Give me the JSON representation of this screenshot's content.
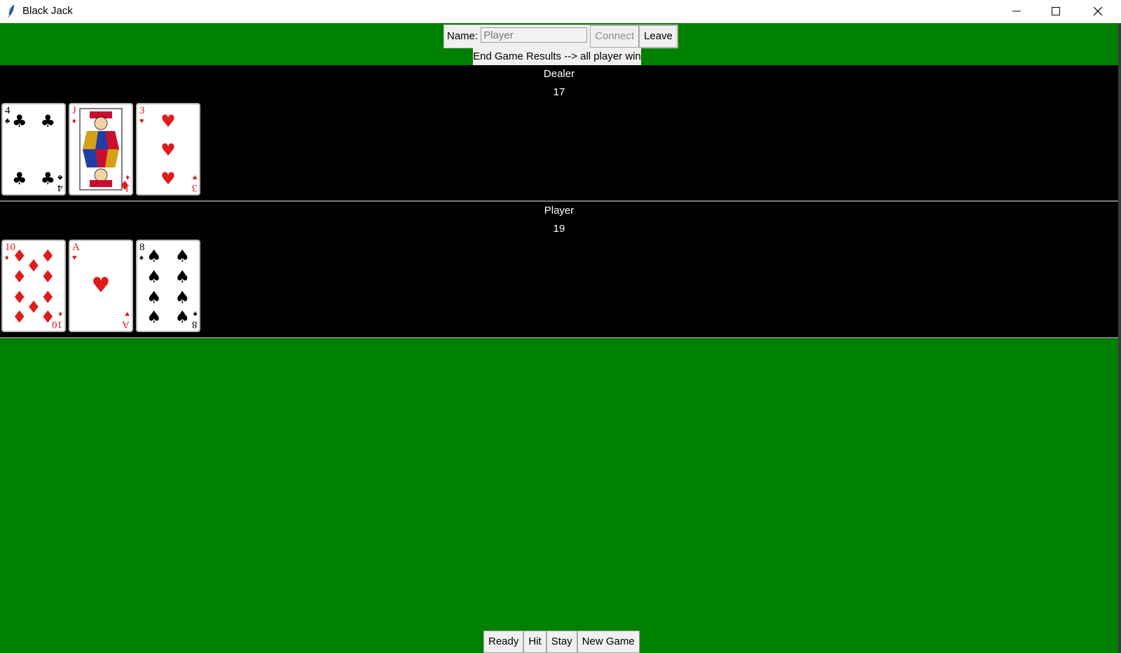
{
  "window": {
    "title": "Black Jack",
    "icon": "feather-icon"
  },
  "connection": {
    "name_label": "Name:",
    "name_placeholder": "Player",
    "connect_label": "Connect",
    "leave_label": "Leave"
  },
  "results_text": "End Game Results --> all player win",
  "dealer": {
    "title": "Dealer",
    "score": "17",
    "cards": [
      {
        "rank": "4",
        "suit": "clubs"
      },
      {
        "rank": "J",
        "suit": "diamonds"
      },
      {
        "rank": "3",
        "suit": "hearts"
      }
    ]
  },
  "player": {
    "title": "Player",
    "score": "19",
    "cards": [
      {
        "rank": "10",
        "suit": "diamonds"
      },
      {
        "rank": "A",
        "suit": "hearts"
      },
      {
        "rank": "8",
        "suit": "spades"
      }
    ]
  },
  "actions": {
    "ready": "Ready",
    "hit": "Hit",
    "stay": "Stay",
    "new_game": "New Game"
  },
  "colors": {
    "table": "#008000",
    "hand_panel": "#000000",
    "red_suit": "#e11a1a"
  }
}
